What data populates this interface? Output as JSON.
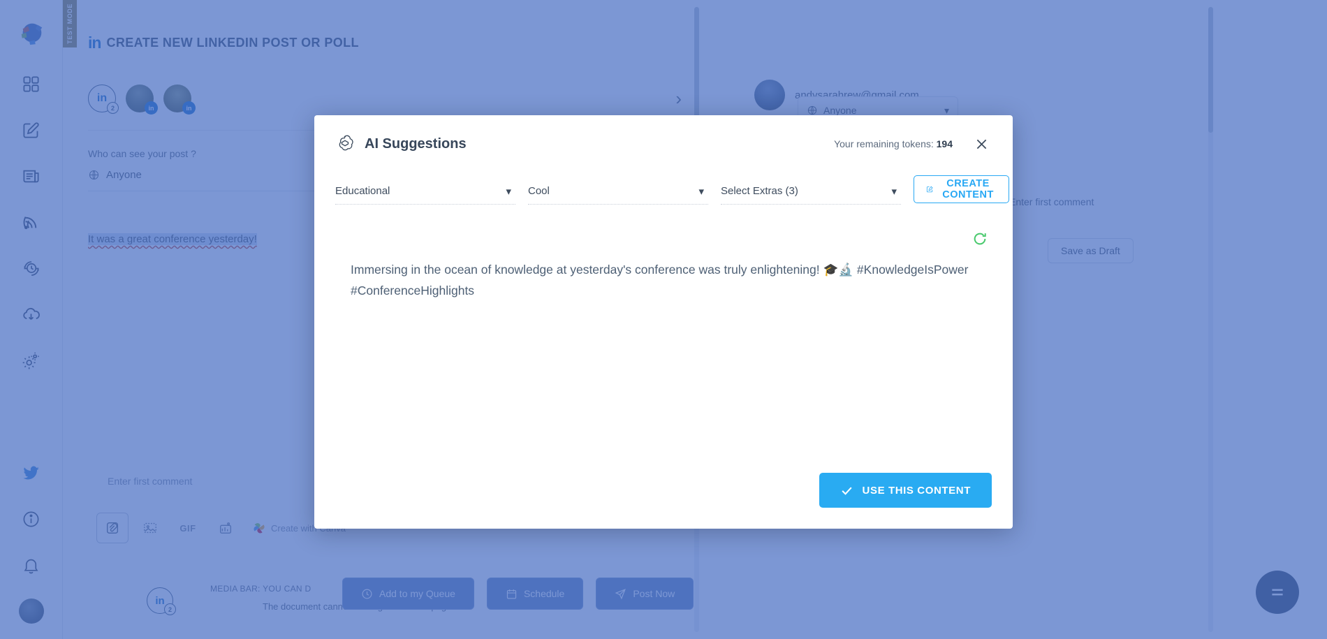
{
  "app": {
    "test_mode_badge": "TEST MODE",
    "page_title": "CREATE NEW LINKEDIN POST OR POLL",
    "in_mark": "in"
  },
  "sidebar": {
    "items": [
      {
        "name": "logo",
        "label": ""
      },
      {
        "name": "dashboard",
        "label": ""
      },
      {
        "name": "compose",
        "label": ""
      },
      {
        "name": "posts",
        "label": ""
      },
      {
        "name": "feed",
        "label": ""
      },
      {
        "name": "schedule",
        "label": ""
      },
      {
        "name": "download",
        "label": ""
      },
      {
        "name": "settings",
        "label": ""
      }
    ],
    "bottom_items": [
      {
        "name": "twitter",
        "label": ""
      },
      {
        "name": "info",
        "label": ""
      },
      {
        "name": "notifications",
        "label": ""
      },
      {
        "name": "account",
        "label": ""
      }
    ]
  },
  "editor": {
    "avatar_badge_count": "2",
    "in_initials": "in",
    "visibility_label": "Who can see your post ?",
    "visibility_value": "Anyone",
    "post_text": "It was a great conference yesterday!",
    "first_comment_placeholder": "Enter first comment",
    "gif_label": "GIF",
    "canva_label": "Create with Canva",
    "media_hint": "MEDIA BAR: YOU CAN D",
    "doc_hint": "The document cannot be longer than 300 pages"
  },
  "compose": {
    "account_email": "andysarahrew@gmail.com",
    "visibility_value": "Anyone",
    "first_comment_label": "Enter first comment",
    "save_draft_label": "Save as Draft"
  },
  "bottom_actions": [
    {
      "label": "Add to my Queue",
      "icon": "clock-icon"
    },
    {
      "label": "Schedule",
      "icon": "calendar-icon"
    },
    {
      "label": "Post Now",
      "icon": "send-icon"
    }
  ],
  "modal": {
    "title": "AI Suggestions",
    "logo_icon": "openai-icon",
    "tokens_label": "Your remaining tokens:",
    "tokens_value": "194",
    "close_icon": "close-icon",
    "dropdowns": [
      {
        "name": "category",
        "value": "Educational"
      },
      {
        "name": "tone",
        "value": "Cool"
      },
      {
        "name": "extras",
        "value": "Select Extras (3)"
      }
    ],
    "create_button": "CREATE CONTENT",
    "regenerate_icon": "refresh-icon",
    "generated_text": "Immersing in the ocean of knowledge at yesterday's conference was truly enlightening! 🎓🔬 #KnowledgeIsPower #ConferenceHighlights",
    "use_button": "USE THIS CONTENT"
  },
  "colors": {
    "accent_blue": "#29abf2",
    "overlay_blue": "#4a6fc4",
    "regen_green": "#49c96d",
    "linkedin_blue": "#0a66c2"
  }
}
